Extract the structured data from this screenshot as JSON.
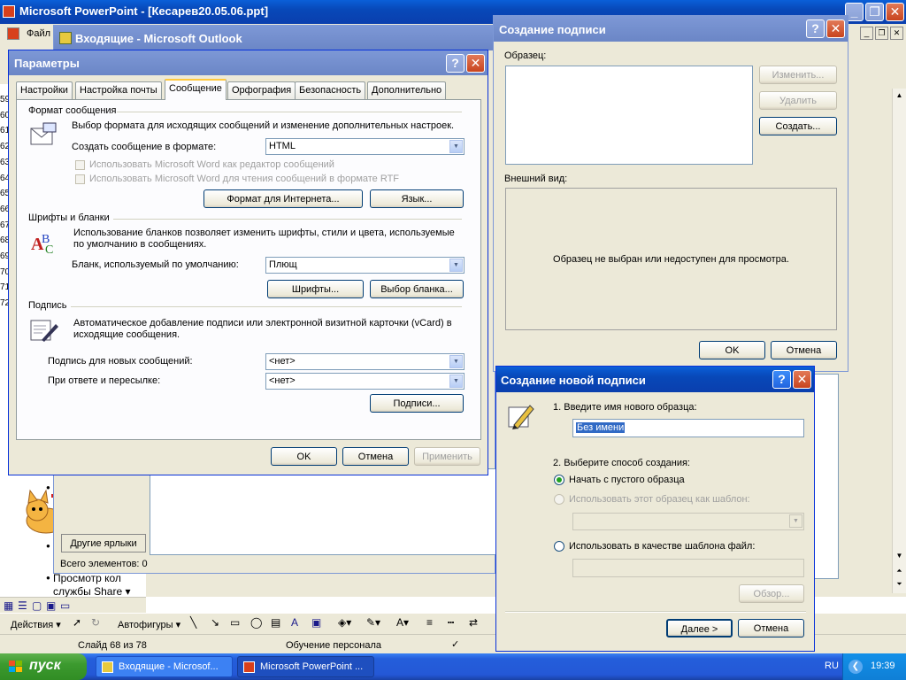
{
  "powerpoint": {
    "title": "Microsoft PowerPoint - [Кесарев20.05.06.ppt]",
    "menu_file": "Файл",
    "status_slide": "Слайд 68 из 78",
    "status_design": "Обучение персонала",
    "draw_actions": "Действия ▾",
    "draw_autoshapes": "Автофигуры ▾",
    "outline_numbers": [
      "59",
      "60",
      "61",
      "62",
      "63",
      "64",
      "65",
      "66",
      "67",
      "68",
      "69",
      "70",
      "71",
      "72"
    ],
    "bullet_text": "Просмотр кол",
    "bullet_text2": "службы Share ▾"
  },
  "outlook": {
    "title": "Входящие - Microsoft Outlook",
    "other_shortcuts": "Другие ярлыки",
    "status": "Всего элементов: 0"
  },
  "options": {
    "title": "Параметры",
    "tabs": [
      "Настройки",
      "Настройка почты",
      "Сообщение",
      "Орфография",
      "Безопасность",
      "Дополнительно"
    ],
    "format_group": "Формат сообщения",
    "format_desc": "Выбор формата для исходящих сообщений и изменение дополнительных настроек.",
    "format_label": "Создать сообщение в формате:",
    "format_value": "HTML",
    "word_editor": "Использовать Microsoft Word как редактор сообщений",
    "word_rtf": "Использовать Microsoft Word для чтения сообщений в формате RTF",
    "internet_btn": "Формат для Интернета...",
    "lang_btn": "Язык...",
    "fonts_group": "Шрифты и бланки",
    "fonts_desc": "Использование бланков позволяет изменить шрифты, стили и цвета, используемые по умолчанию в сообщениях.",
    "stationery_label": "Бланк, используемый по умолчанию:",
    "stationery_value": "Плющ",
    "fonts_btn": "Шрифты...",
    "choose_btn": "Выбор бланка...",
    "sig_group": "Подпись",
    "sig_desc": "Автоматическое добавление подписи или электронной визитной карточки (vCard) в исходящие сообщения.",
    "sig_new_label": "Подпись для новых сообщений:",
    "sig_new_value": "<нет>",
    "sig_reply_label": "При ответе и пересылке:",
    "sig_reply_value": "<нет>",
    "sig_btn": "Подписи...",
    "ok": "OK",
    "cancel": "Отмена",
    "apply": "Применить"
  },
  "create_sig": {
    "title": "Создание подписи",
    "sample_label": "Образец:",
    "edit_btn": "Изменить...",
    "delete_btn": "Удалить",
    "create_btn": "Создать...",
    "preview_label": "Внешний вид:",
    "preview_msg": "Образец не выбран или недоступен для просмотра.",
    "ok": "OK",
    "cancel": "Отмена"
  },
  "new_sig": {
    "title": "Создание новой подписи",
    "step1": "1. Введите имя нового образца:",
    "name_value": "Без имени",
    "step2": "2. Выберите способ создания:",
    "opt_blank": "Начать с пустого образца",
    "opt_template": "Использовать этот образец как шаблон:",
    "opt_file": "Использовать в качестве шаблона файл:",
    "browse_btn": "Обзор...",
    "next_btn": "Далее >",
    "cancel_btn": "Отмена"
  },
  "taskbar": {
    "start": "пуск",
    "task_outlook": "Входящие - Microsof...",
    "task_ppt": "Microsoft PowerPoint ...",
    "lang": "RU",
    "clock": "19:39"
  }
}
